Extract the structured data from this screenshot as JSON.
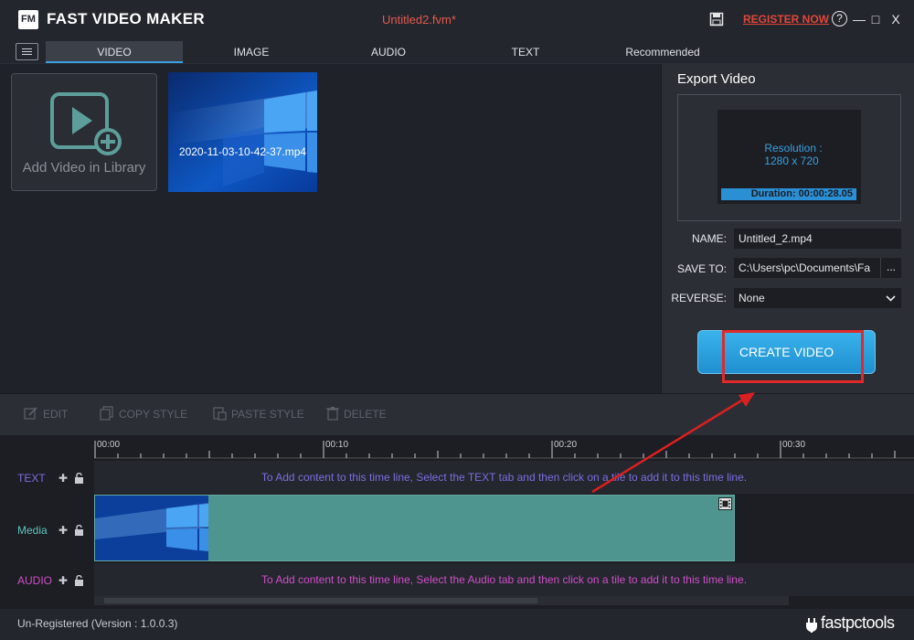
{
  "window": {
    "app_title": "FAST VIDEO MAKER",
    "logo_text": "FM",
    "document_title": "Untitled2.fvm*",
    "register_label": "REGISTER NOW",
    "help_label": "?",
    "minimize_label": "—",
    "maximize_label": "□",
    "close_label": "X"
  },
  "tabs": [
    {
      "label": "VIDEO",
      "active": true
    },
    {
      "label": "IMAGE",
      "active": false
    },
    {
      "label": "AUDIO",
      "active": false
    },
    {
      "label": "TEXT",
      "active": false
    },
    {
      "label": "Recommended",
      "active": false
    }
  ],
  "library": {
    "add_label": "Add Video in Library",
    "items": [
      {
        "file_name": "2020-11-03-10-42-37.mp4"
      }
    ]
  },
  "export": {
    "title": "Export Video",
    "resolution_label": "Resolution :",
    "resolution_value": "1280 x 720",
    "duration_text": "Duration: 00:00:28.05",
    "name_label": "NAME:",
    "name_value": "Untitled_2.mp4",
    "save_to_label": "SAVE TO:",
    "save_to_value": "C:\\Users\\pc\\Documents\\Fa",
    "browse_label": "...",
    "reverse_label": "REVERSE:",
    "reverse_value": "None",
    "create_label": "CREATE VIDEO"
  },
  "toolbar": {
    "edit_label": "EDIT",
    "copy_style_label": "COPY STYLE",
    "paste_style_label": "PASTE STYLE",
    "delete_label": "DELETE"
  },
  "timeline": {
    "ticks": [
      "00:00",
      "00:10",
      "00:20",
      "00:30"
    ],
    "tracks": {
      "text": {
        "label": "TEXT",
        "hint": "To Add content to this time line, Select the TEXT tab and then click on a tile to add it to this time line."
      },
      "media": {
        "label": "Media"
      },
      "audio": {
        "label": "AUDIO",
        "hint": "To Add content to this time line, Select the Audio tab and then click on a tile to add it to this time line."
      }
    },
    "add_symbol": "✚",
    "lock_symbol": "🔒"
  },
  "status": {
    "text": "Un-Registered (Version : 1.0.0.3)",
    "brand": "fastpctools"
  },
  "colors": {
    "accent": "#3aa0e0",
    "register": "#e0463a",
    "highlight": "#e02a2a",
    "media_clip": "#4e948f",
    "text_track": "#7a6fe0",
    "audio_track": "#d04fc8"
  }
}
